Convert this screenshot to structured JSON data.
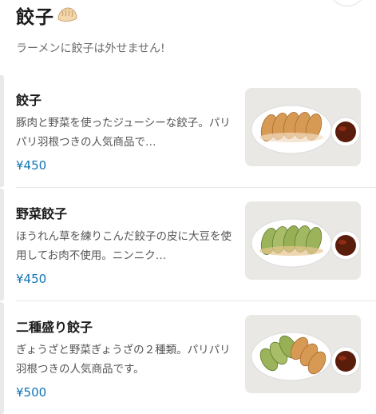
{
  "section": {
    "title": "餃子",
    "title_emoji_icon": "gyoza-emoji-icon",
    "description": "ラーメンに餃子は外せません!"
  },
  "items": [
    {
      "name": "餃子",
      "description": "豚肉と野菜を使ったジューシーな餃子。パリパリ羽根つきの人気商品で…",
      "price": "¥450",
      "image_icon": "gyoza-plate-image"
    },
    {
      "name": "野菜餃子",
      "description": "ほうれん草を練りこんだ餃子の皮に大豆を使用してお肉不使用。ニンニク…",
      "price": "¥450",
      "image_icon": "vegetable-gyoza-plate-image"
    },
    {
      "name": "二種盛り餃子",
      "description": "ぎょうざと野菜ぎょうざの２種類。パリパリ羽根つきの人気商品です。",
      "price": "¥500",
      "image_icon": "mixed-gyoza-plate-image"
    }
  ],
  "colors": {
    "price": "#1173b4",
    "text": "#1a1a1a",
    "description": "#555555"
  }
}
